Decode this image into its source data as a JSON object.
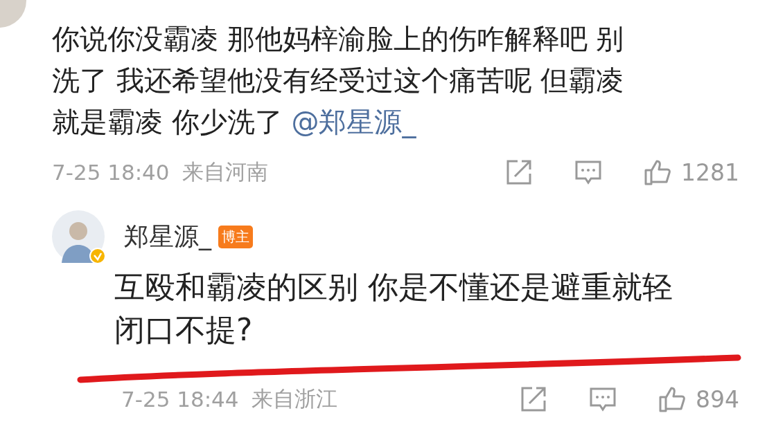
{
  "comment": {
    "text": "你说你没霸凌 那他妈梓渝脸上的伤咋解释吧 别洗了 我还希望他没有经受过这个痛苦呢 但霸凌就是霸凌 你少洗了 ",
    "mention": "@郑星源_",
    "time": "7-25 18:40",
    "location": "来自河南",
    "likes": "1281"
  },
  "reply": {
    "author": "郑星源_",
    "badge": "博主",
    "verified": true,
    "text": "互殴和霸凌的区别 你是不懂还是避重就轻闭口不提?",
    "time": "7-25 18:44",
    "location": "来自浙江",
    "likes": "894"
  }
}
